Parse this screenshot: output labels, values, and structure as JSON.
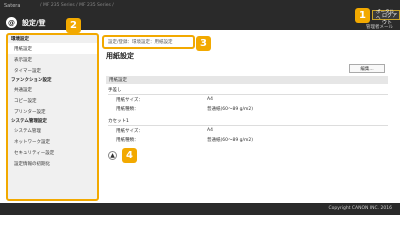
{
  "header": {
    "brand": "Satera",
    "breadcrumb_top": "/ MF 235 Series / MF 235 Series /",
    "logo": "@",
    "title": "設定/登",
    "portal_label": "ポータルへ",
    "logout_label": "ログアウト",
    "mail_label": "管理者メール"
  },
  "sidebar": {
    "sections": [
      {
        "heading": "環境設定",
        "items": [
          "用紙設定",
          "表示設定",
          "タイマー設定"
        ]
      },
      {
        "heading": "ファンクション設定",
        "items": [
          "共通設定",
          "コピー設定",
          "プリンター設定"
        ]
      },
      {
        "heading": "システム管理設定",
        "items": [
          "システム管理",
          "ネットワーク設定",
          "セキュリティー設定",
          "設定情報の初期化"
        ]
      }
    ]
  },
  "main": {
    "breadcrumb": "設定/登録：環境設定：用紙設定",
    "title": "用紙設定",
    "edit_label": "編集...",
    "section_title": "用紙設定",
    "groups": [
      {
        "name": "手差し",
        "rows": [
          {
            "key": "用紙サイズ：",
            "value": "A4"
          },
          {
            "key": "用紙種類：",
            "value": "普通紙(60～89 g/m2)"
          }
        ]
      },
      {
        "name": "カセット1",
        "rows": [
          {
            "key": "用紙サイズ：",
            "value": "A4"
          },
          {
            "key": "用紙種類：",
            "value": "普通紙(60～89 g/m2)"
          }
        ]
      }
    ],
    "up_icon": "▲"
  },
  "footer": {
    "copyright": "Copyright CANON INC. 2016"
  },
  "badges": [
    "1",
    "2",
    "3",
    "4"
  ],
  "colors": {
    "accent": "#f2a900",
    "topbar": "#2a2a2a",
    "sidebar": "#f0f0f0"
  }
}
